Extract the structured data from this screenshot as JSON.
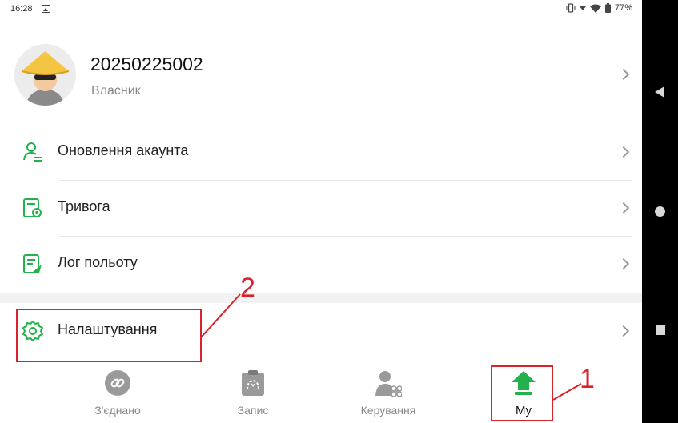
{
  "status_bar": {
    "time": "16:28",
    "battery": "77%"
  },
  "profile": {
    "username": "20250225002",
    "role": "Власник"
  },
  "menu": [
    {
      "label": "Оновлення акаунта",
      "icon": "account-update-icon"
    },
    {
      "label": "Тривога",
      "icon": "alarm-icon"
    },
    {
      "label": "Лог польоту",
      "icon": "flight-log-icon"
    },
    {
      "label": "Налаштування",
      "icon": "settings-gear-icon"
    }
  ],
  "tabs": [
    {
      "label": "З'єднано",
      "icon": "link-icon"
    },
    {
      "label": "Запис",
      "icon": "record-clipboard-icon"
    },
    {
      "label": "Керування",
      "icon": "user-drone-icon"
    },
    {
      "label": "My",
      "icon": "home-arrow-icon",
      "active": true
    }
  ],
  "annotations": {
    "label_1": "1",
    "label_2": "2"
  },
  "colors": {
    "accent_green": "#22b14c",
    "annotation_red": "#d9232a"
  }
}
